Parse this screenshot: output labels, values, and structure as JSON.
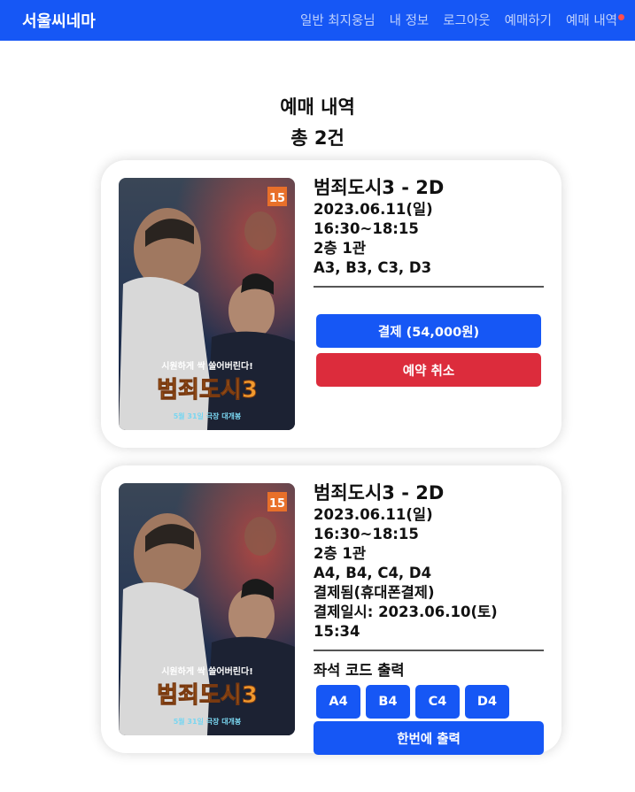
{
  "navbar": {
    "brand": "서울씨네마",
    "links": [
      "일반 최지웅님",
      "내 정보",
      "로그아웃",
      "예매하기",
      "예매 내역"
    ]
  },
  "page": {
    "title": "예매 내역",
    "count": "총 2건"
  },
  "poster": {
    "rating": "15",
    "tagline": "시원하게 싹 쓸어버린다!",
    "logo": "범죄도시3",
    "release": "5월 31일 극장 대개봉"
  },
  "bookings": [
    {
      "title": "범죄도시3 - 2D",
      "date": "2023.06.11(일)",
      "time": "16:30~18:15",
      "hall": "2층 1관",
      "seats": "A3, B3, C3, D3",
      "pay_label": "결제 (54,000원)",
      "cancel_label": "예약 취소"
    },
    {
      "title": "범죄도시3 - 2D",
      "date": "2023.06.11(일)",
      "time": "16:30~18:15",
      "hall": "2층 1관",
      "seats": "A4, B4, C4, D4",
      "payment_status": "결제됨(휴대폰결제)",
      "payment_time": "결제일시: 2023.06.10(토) 15:34",
      "seat_code_heading": "좌석 코드 출력",
      "seat_codes": [
        "A4",
        "B4",
        "C4",
        "D4"
      ],
      "print_all_label": "한번에 출력"
    }
  ],
  "colors": {
    "primary": "#1657f5",
    "danger": "#dc2c3c",
    "nav_badge": "#ff4d4f"
  }
}
